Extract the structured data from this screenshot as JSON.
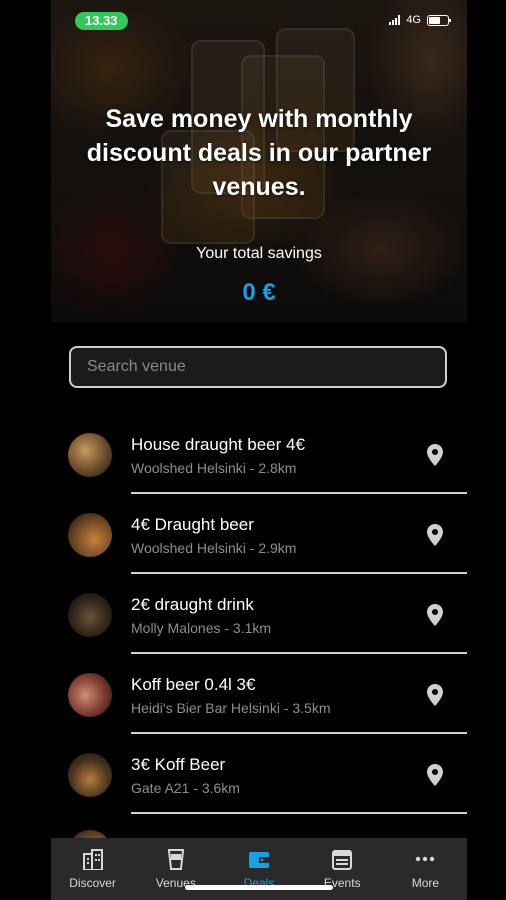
{
  "status_bar": {
    "time": "13.33",
    "network": "4G"
  },
  "hero": {
    "title": "Save money with monthly discount deals in our partner venues.",
    "savings_label": "Your total savings",
    "savings_value": "0 €"
  },
  "search": {
    "placeholder": "Search venue"
  },
  "deals": [
    {
      "title": "House draught beer 4€",
      "subtitle": "Woolshed Helsinki - 2.8km"
    },
    {
      "title": "4€ Draught beer",
      "subtitle": "Woolshed Helsinki - 2.9km"
    },
    {
      "title": "2€ draught drink",
      "subtitle": "Molly Malones - 3.1km"
    },
    {
      "title": "Koff beer 0.4l 3€",
      "subtitle": "Heidi's Bier Bar Helsinki - 3.5km"
    },
    {
      "title": "3€ Koff Beer",
      "subtitle": "Gate A21 - 3.6km"
    }
  ],
  "tabs": [
    {
      "label": "Discover",
      "icon": "building-icon"
    },
    {
      "label": "Venues",
      "icon": "cup-icon"
    },
    {
      "label": "Deals",
      "icon": "wallet-icon"
    },
    {
      "label": "Events",
      "icon": "calendar-icon"
    },
    {
      "label": "More",
      "icon": "more-dots-icon"
    }
  ],
  "colors": {
    "accent": "#1a9fe3",
    "status_time_bg": "#34c759",
    "tabbar_bg": "#2a2a2a"
  }
}
